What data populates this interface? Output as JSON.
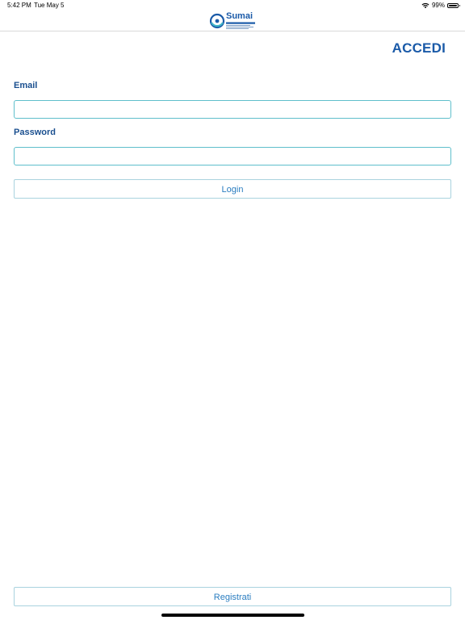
{
  "status_bar": {
    "time": "5:42 PM",
    "date": "Tue May 5",
    "battery_percent": "99%",
    "battery_level": 0.99,
    "wifi_icon": "wifi-icon",
    "battery_icon": "battery-icon"
  },
  "header": {
    "logo_text": "Sumai",
    "logo_icon": "sumai-logo-icon"
  },
  "login": {
    "title": "ACCEDI",
    "email_label": "Email",
    "email_value": "",
    "password_label": "Password",
    "password_value": "",
    "login_button": "Login",
    "register_button": "Registrati"
  },
  "colors": {
    "accent": "#1a5aa8",
    "label": "#1a4f8f",
    "input_border": "#5fbfcb",
    "button_text": "#2a7dc0"
  }
}
